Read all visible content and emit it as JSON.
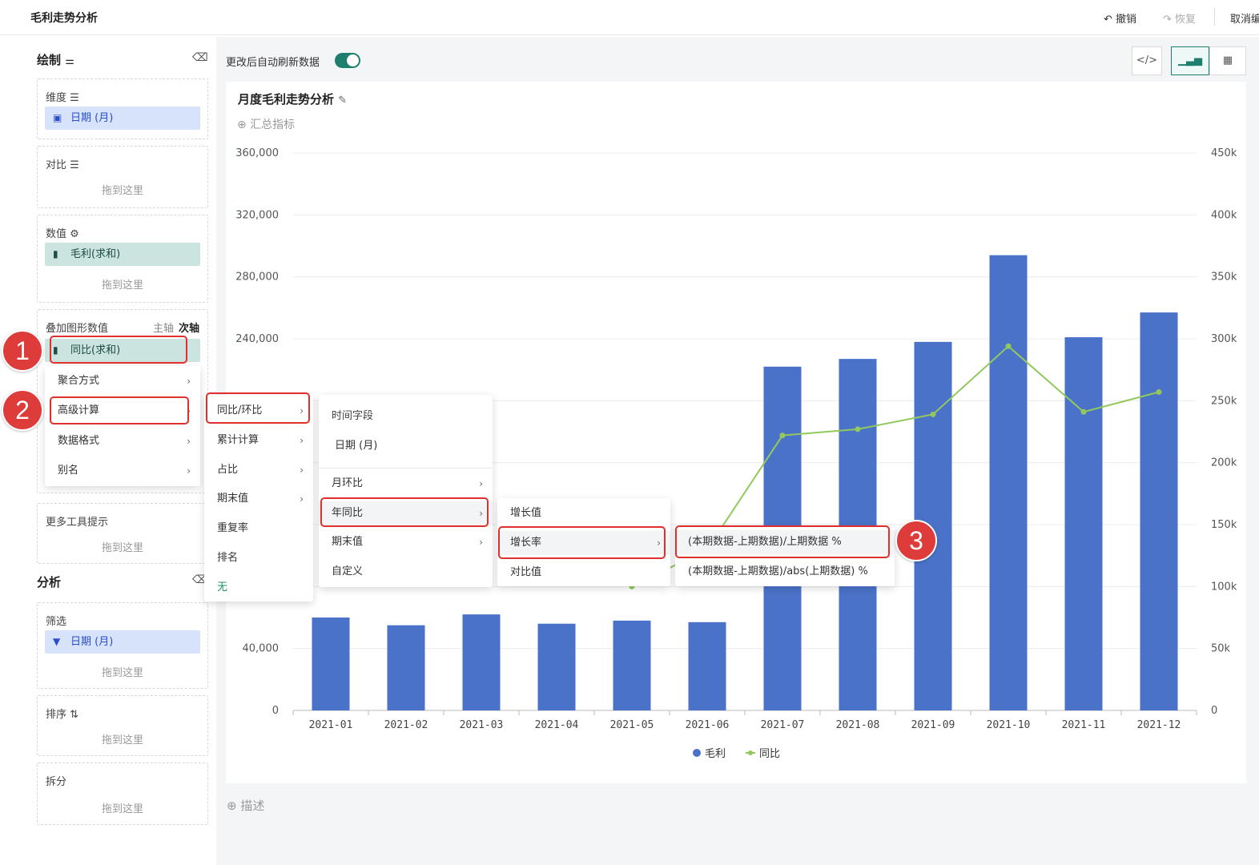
{
  "header": {
    "title": "毛利走势分析",
    "undo": "撤销",
    "redo": "恢复",
    "cancel": "取消编"
  },
  "left": {
    "draw_title": "绘制",
    "dimension_label": "维度",
    "dimension_pill": "日期 (月)",
    "compare_label": "对比",
    "drop_here": "拖到这里",
    "value_label": "数值",
    "value_pill": "毛利(求和)",
    "overlay_label": "叠加图形数值",
    "main_axis": "主轴",
    "sub_axis": "次轴",
    "overlay_pill": "同比(求和)",
    "tooltip_label": "更多工具提示",
    "analysis_title": "分析",
    "filter_label": "筛选",
    "filter_pill": "日期 (月)",
    "sort_label": "排序",
    "split_label": "拆分"
  },
  "toolbar": {
    "auto_refresh": "更改后自动刷新数据",
    "auto_refresh_on": true
  },
  "chart_title": "月度毛利走势分析",
  "add_metric": "汇总指标",
  "describe": "描述",
  "menus": {
    "menu1": [
      "聚合方式",
      "高级计算",
      "数据格式",
      "别名"
    ],
    "menu2": [
      "同比/环比",
      "累计计算",
      "占比",
      "期末值",
      "重复率",
      "排名",
      "无"
    ],
    "menu3_header": "时间字段",
    "menu3_field": "日期 (月)",
    "menu3": [
      "月环比",
      "年同比",
      "期末值",
      "自定义"
    ],
    "menu4": [
      "增长值",
      "增长率",
      "对比值"
    ],
    "menu5": [
      "(本期数据-上期数据)/上期数据 %",
      "(本期数据-上期数据)/abs(上期数据) %"
    ]
  },
  "badges": [
    "1",
    "2",
    "3"
  ],
  "chart_data": {
    "type": "bar",
    "categories": [
      "2021-01",
      "2021-02",
      "2021-03",
      "2021-04",
      "2021-05",
      "2021-06",
      "2021-07",
      "2021-08",
      "2021-09",
      "2021-10",
      "2021-11",
      "2021-12"
    ],
    "series": [
      {
        "name": "毛利",
        "type": "bar",
        "axis": "left",
        "color": "#4a72c8",
        "values": [
          60000,
          55000,
          62000,
          56000,
          58000,
          57000,
          222000,
          227000,
          238000,
          294000,
          241000,
          257000
        ]
      },
      {
        "name": "同比",
        "type": "line",
        "axis": "right",
        "color": "#93c85e",
        "values": [
          null,
          null,
          null,
          null,
          100000,
          130000,
          222000,
          227000,
          239000,
          294000,
          241000,
          257000
        ]
      }
    ],
    "yleft_ticks": [
      "0",
      "40,000",
      "240,000",
      "280,000",
      "320,000",
      "360,000"
    ],
    "yleft_ticks_vals": [
      0,
      40000,
      240000,
      280000,
      320000,
      360000
    ],
    "ylim_left": [
      0,
      360000
    ],
    "yright_ticks": [
      "0",
      "50k",
      "100k",
      "150k",
      "200k",
      "250k",
      "300k",
      "350k",
      "400k",
      "450k"
    ],
    "ylim_right": [
      0,
      450000
    ],
    "legend": "bottom-center",
    "grid": true
  }
}
